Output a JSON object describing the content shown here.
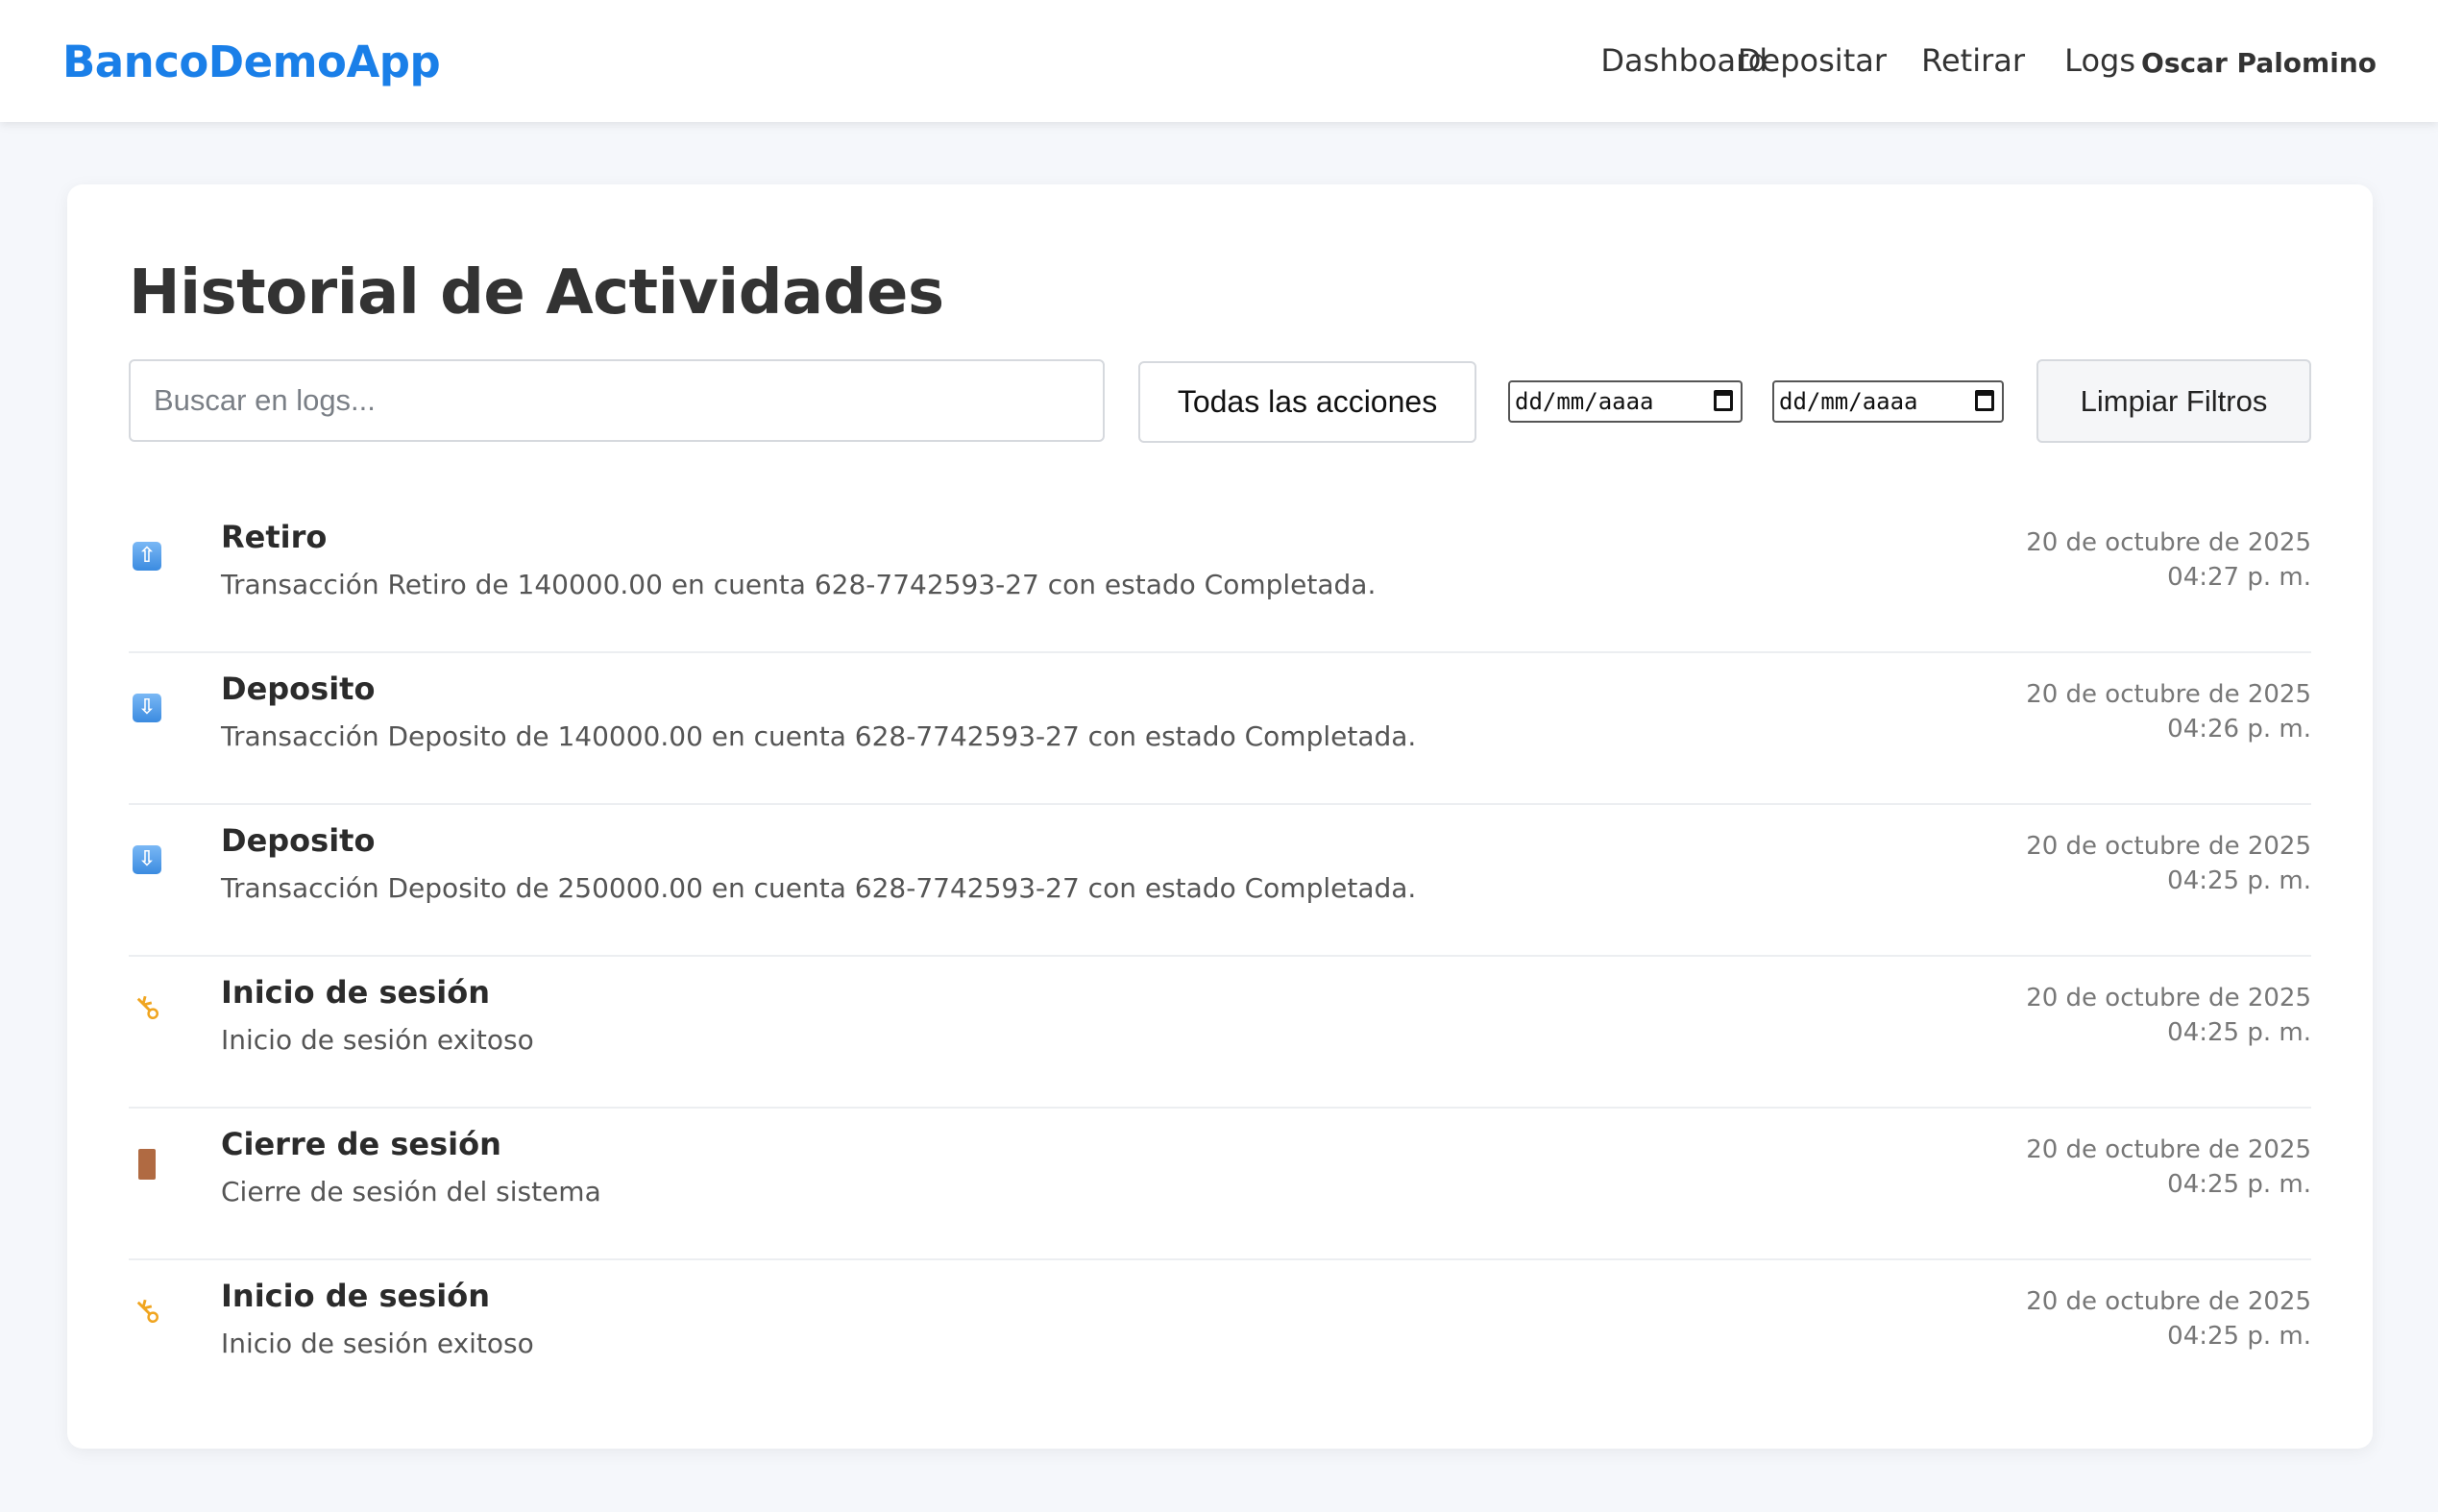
{
  "navbar": {
    "brand": "BancoDemoApp",
    "links": [
      "Dashboard",
      "Depositar",
      "Retirar",
      "Logs"
    ],
    "user": "Oscar Palomino"
  },
  "page": {
    "title": "Historial de Actividades"
  },
  "filters": {
    "search_placeholder": "Buscar en logs...",
    "action_select": "Todas las acciones",
    "date_from_placeholder": "dd/mm/aaaa",
    "date_to_placeholder": "dd/mm/aaaa",
    "clear_label": "Limpiar Filtros"
  },
  "logs": [
    {
      "icon": "arrow-up-icon",
      "action": "Retiro",
      "description": "Transacción Retiro de 140000.00 en cuenta 628-7742593-27 con estado Completada.",
      "date": "20 de octubre de 2025",
      "time": "04:27 p. m."
    },
    {
      "icon": "arrow-down-icon",
      "action": "Deposito",
      "description": "Transacción Deposito de 140000.00 en cuenta 628-7742593-27 con estado Completada.",
      "date": "20 de octubre de 2025",
      "time": "04:26 p. m."
    },
    {
      "icon": "arrow-down-icon",
      "action": "Deposito",
      "description": "Transacción Deposito de 250000.00 en cuenta 628-7742593-27 con estado Completada.",
      "date": "20 de octubre de 2025",
      "time": "04:25 p. m."
    },
    {
      "icon": "key-icon",
      "action": "Inicio de sesión",
      "description": "Inicio de sesión exitoso",
      "date": "20 de octubre de 2025",
      "time": "04:25 p. m."
    },
    {
      "icon": "door-icon",
      "action": "Cierre de sesión",
      "description": "Cierre de sesión del sistema",
      "date": "20 de octubre de 2025",
      "time": "04:25 p. m."
    },
    {
      "icon": "key-icon",
      "action": "Inicio de sesión",
      "description": "Inicio de sesión exitoso",
      "date": "20 de octubre de 2025",
      "time": "04:25 p. m."
    }
  ]
}
